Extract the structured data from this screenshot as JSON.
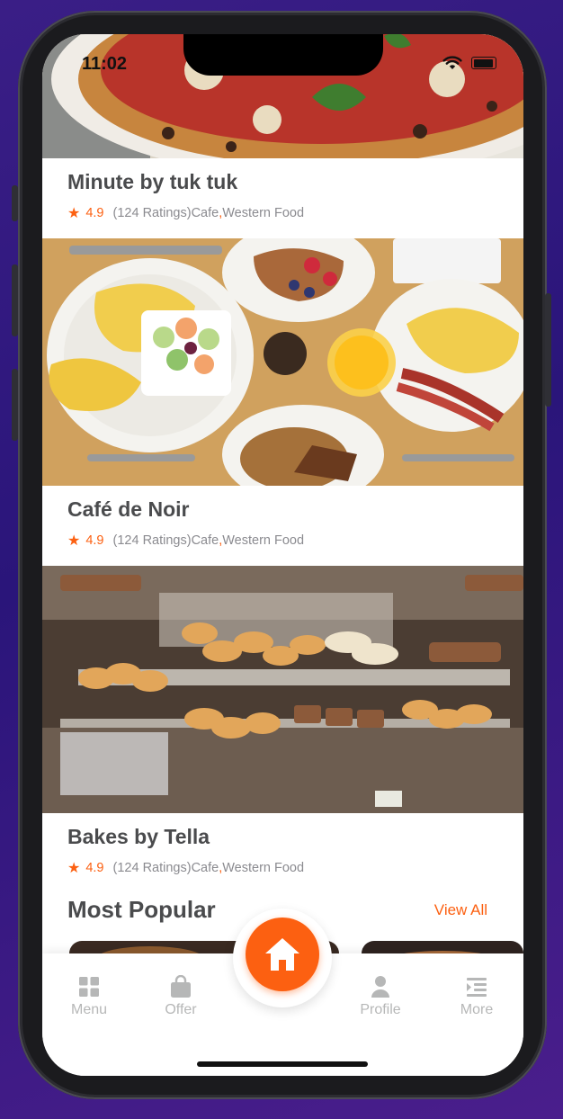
{
  "status_bar": {
    "time": "11:02"
  },
  "restaurants": [
    {
      "name": "Minute by tuk tuk",
      "rating": "4.9",
      "ratings_count": "(124 Ratings)",
      "category": "Cafe",
      "separator": ",",
      "cuisine": "Western Food"
    },
    {
      "name": "Café de Noir",
      "rating": "4.9",
      "ratings_count": "(124 Ratings)",
      "category": "Cafe",
      "separator": ",",
      "cuisine": "Western Food"
    },
    {
      "name": "Bakes by Tella",
      "rating": "4.9",
      "ratings_count": "(124 Ratings)",
      "category": "Cafe",
      "separator": ",",
      "cuisine": "Western Food"
    }
  ],
  "most_popular": {
    "title": "Most Popular",
    "view_all": "View All"
  },
  "tabbar": {
    "items": [
      {
        "label": "Menu",
        "icon": "grid-icon"
      },
      {
        "label": "Offer",
        "icon": "shopping-bag-icon"
      },
      {
        "label": "Home",
        "icon": "home-icon"
      },
      {
        "label": "Profile",
        "icon": "person-icon"
      },
      {
        "label": "More",
        "icon": "menu-list-icon"
      }
    ]
  },
  "colors": {
    "accent": "#fc6011",
    "title_text": "#4a4b4d",
    "secondary_text": "#8b8b90",
    "tab_inactive": "#b6b7b7"
  }
}
